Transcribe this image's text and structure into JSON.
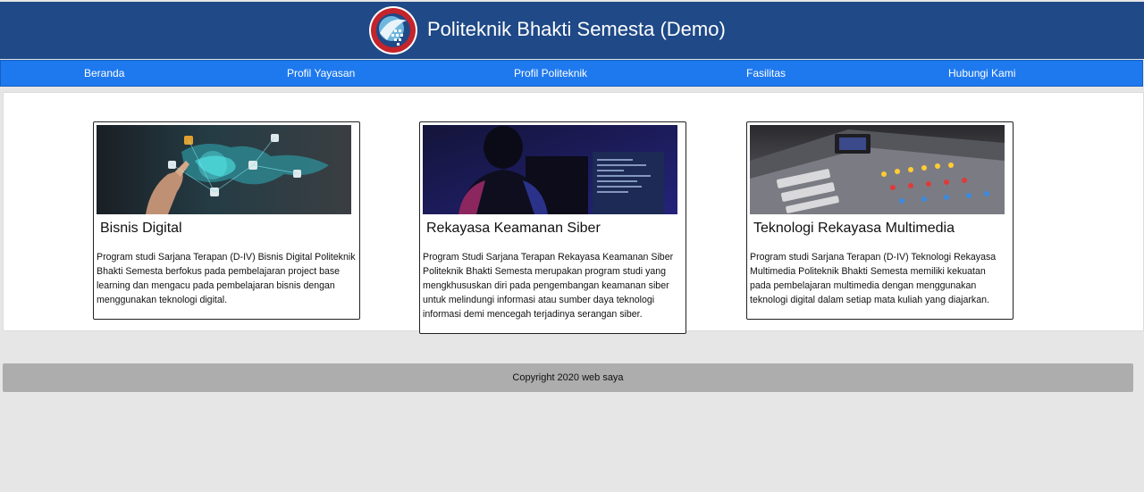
{
  "header": {
    "title": "Politeknik Bhakti Semesta (Demo)",
    "logo_icon": "college-logo-icon"
  },
  "nav": {
    "items": [
      {
        "label": "Beranda"
      },
      {
        "label": "Profil Yayasan"
      },
      {
        "label": "Profil Politeknik"
      },
      {
        "label": "Fasilitas"
      },
      {
        "label": "Hubungi Kami"
      }
    ]
  },
  "cards": [
    {
      "title": "Bisnis Digital",
      "image_icon": "digital-business-world-map-image",
      "description": "Program studi Sarjana Terapan (D-IV) Bisnis Digital Politeknik Bhakti Semesta berfokus pada pembelajaran project base learning dan mengacu pada pembelajaran bisnis dengan menggunakan teknologi digital."
    },
    {
      "title": "Rekayasa Keamanan Siber",
      "image_icon": "cyber-security-monitor-image",
      "description": "Program Studi Sarjana Terapan Rekayasa Keamanan Siber Politeknik Bhakti Semesta merupakan program studi yang mengkhususkan diri pada pengembangan keamanan siber untuk melindungi informasi atau sumber daya teknologi informasi demi mencegah terjadinya serangan siber."
    },
    {
      "title": "Teknologi Rekayasa Multimedia",
      "image_icon": "audio-mixer-console-image",
      "description": "Program studi Sarjana Terapan (D-IV) Teknologi Rekayasa Multimedia Politeknik Bhakti Semesta memiliki kekuatan pada pembelajaran multimedia dengan menggunakan teknologi digital dalam setiap mata kuliah yang diajarkan."
    }
  ],
  "footer": {
    "text": "Copyright 2020 web saya"
  },
  "colors": {
    "header": "#1f4987",
    "nav": "#1e79ee",
    "footer": "#adadad",
    "background": "#e6e6e6"
  }
}
